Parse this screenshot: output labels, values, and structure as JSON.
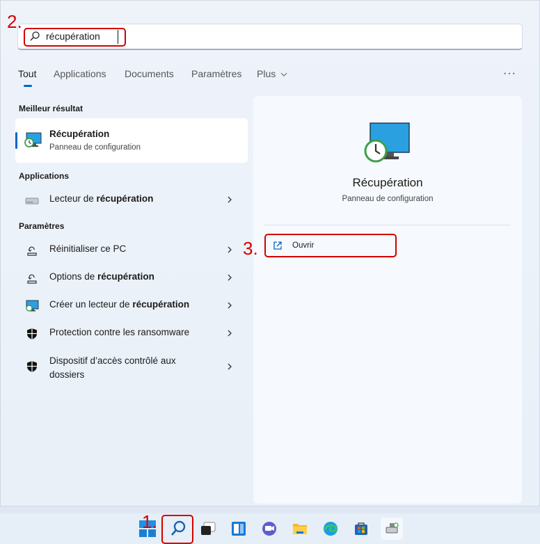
{
  "search": {
    "value": "récupération",
    "placeholder": ""
  },
  "annotations": {
    "step1": "1.",
    "step2": "2.",
    "step3": "3."
  },
  "tabs": [
    {
      "label": "Tout",
      "active": true
    },
    {
      "label": "Applications"
    },
    {
      "label": "Documents"
    },
    {
      "label": "Paramètres"
    },
    {
      "label": "Plus"
    }
  ],
  "more_menu": "···",
  "best_match": {
    "section": "Meilleur résultat",
    "title": "Récupération",
    "subtitle": "Panneau de configuration",
    "icon": "recovery-control-panel-icon"
  },
  "apps": {
    "section": "Applications",
    "items": [
      {
        "prefix": "Lecteur de ",
        "bold": "récupération",
        "suffix": "",
        "icon": "drive-icon"
      }
    ]
  },
  "settings": {
    "section": "Paramètres",
    "items": [
      {
        "prefix": "Réinitialiser ce PC",
        "bold": "",
        "suffix": "",
        "icon": "reset-icon"
      },
      {
        "prefix": "Options de ",
        "bold": "récupération",
        "suffix": "",
        "icon": "recovery-options-icon"
      },
      {
        "prefix": "Créer un lecteur de ",
        "bold": "récupération",
        "suffix": "",
        "icon": "monitor-icon"
      },
      {
        "prefix": "Protection contre les ransomware",
        "bold": "",
        "suffix": "",
        "icon": "shield-icon"
      },
      {
        "prefix": "Dispositif d’accès contrôlé aux dossiers",
        "bold": "",
        "suffix": "",
        "icon": "shield-icon"
      }
    ]
  },
  "preview": {
    "title": "Récupération",
    "subtitle": "Panneau de configuration",
    "action_label": "Ouvrir",
    "action_icon": "open-external-icon"
  },
  "taskbar": [
    "start-icon",
    "search-icon",
    "task-view-icon",
    "widgets-icon",
    "teams-chat-icon",
    "file-explorer-icon",
    "edge-icon",
    "store-icon",
    "recovery-drive-icon"
  ],
  "colors": {
    "accent": "#0067c0",
    "annotation": "#d40000"
  }
}
